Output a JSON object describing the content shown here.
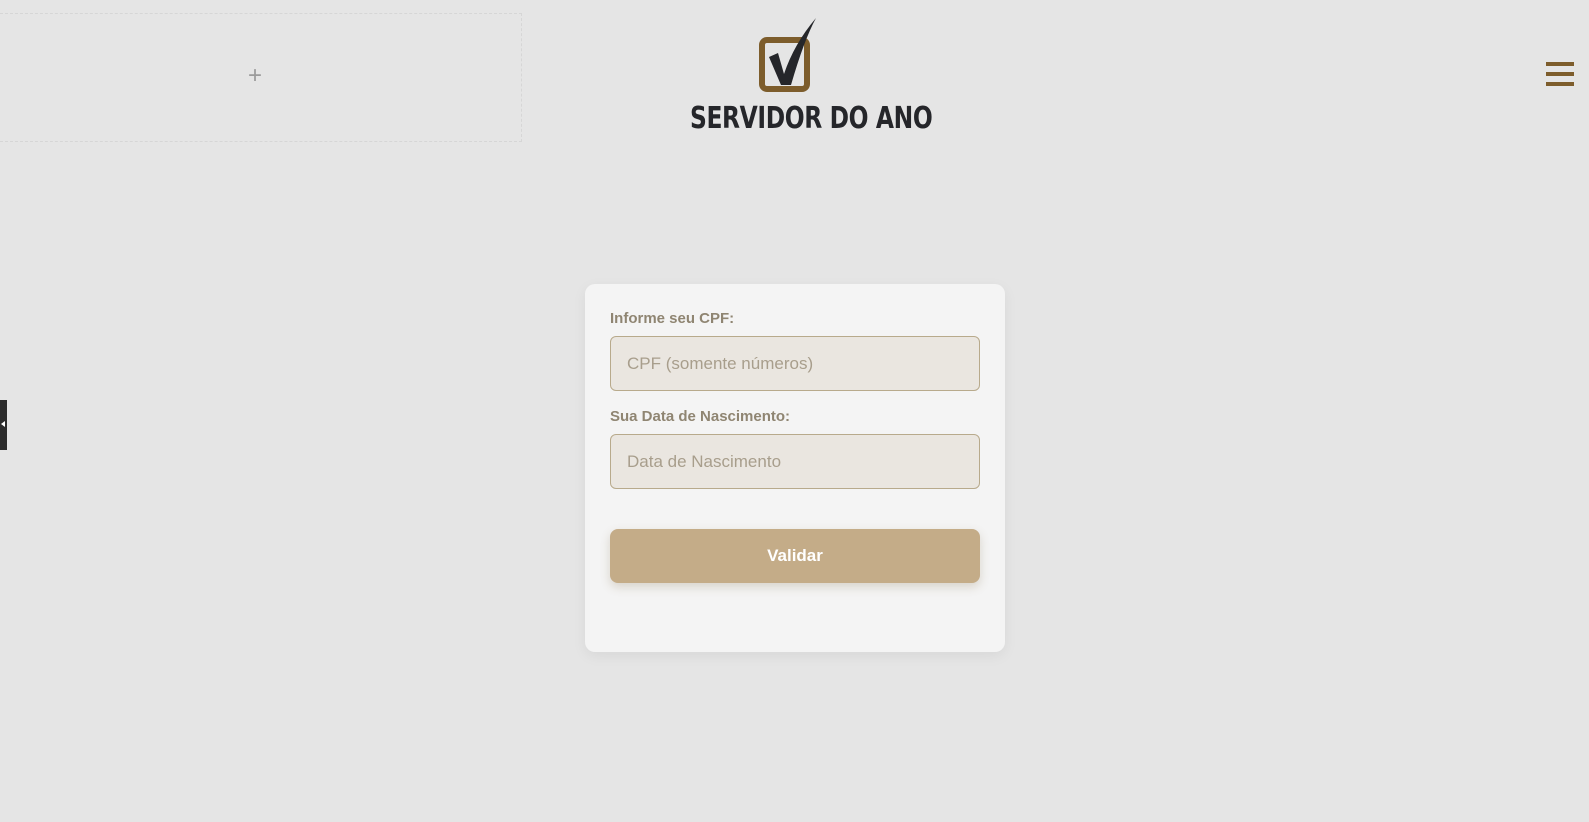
{
  "placeholder_block": {
    "add_glyph": "+"
  },
  "logo": {
    "text": "SERVIDOR DO ANO",
    "icon": "checkbox-check-icon",
    "colors": {
      "box": "#7d5d2c",
      "check": "#25262a",
      "text": "#25262a"
    }
  },
  "header": {
    "menu_icon": "hamburger-menu-icon",
    "accent": "#7d5d2c"
  },
  "side_panel": {
    "icon": "chevron-left-icon"
  },
  "form": {
    "cpf_label": "Informe seu CPF:",
    "cpf_placeholder": "CPF (somente números)",
    "cpf_value": "",
    "dob_label": "Sua Data de Nascimento:",
    "dob_placeholder": "Data de Nascimento",
    "dob_value": "",
    "submit_label": "Validar",
    "colors": {
      "button": "#c4ac88",
      "input_bg": "#eae6e0",
      "input_border": "#b8aa8c",
      "label": "#8f8572",
      "card_bg": "#f4f4f4",
      "page_bg": "#e5e5e5"
    }
  }
}
